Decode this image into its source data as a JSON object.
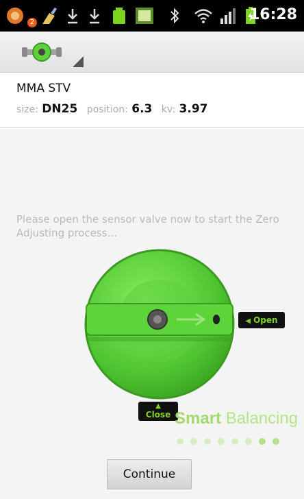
{
  "status_bar": {
    "time": "16:28",
    "notification_count": "2",
    "icons": [
      "notification-app-icon",
      "cleaner-icon",
      "download-icon",
      "download-icon",
      "battery-app-icon",
      "checklist-icon",
      "bluetooth-icon",
      "wifi-icon",
      "signal-icon",
      "battery-charging-icon"
    ]
  },
  "action_bar": {
    "logo_icon": "valve-logo-icon",
    "spinner_icon": "dropdown-triangle-icon"
  },
  "valve": {
    "name": "MMA STV",
    "size_label": "size:",
    "size_value": "DN25",
    "position_label": "position:",
    "position_value": "6.3",
    "kv_label": "kv:",
    "kv_value": "3.97"
  },
  "instruction": "Please open the sensor valve now to start the Zero Adjusting process...",
  "open_button": {
    "label": "Open"
  },
  "close_button": {
    "label": "Close"
  },
  "brand": {
    "part1": "Smart",
    "part2": " Balancing"
  },
  "progress": {
    "total": 8,
    "active": [
      6,
      7
    ]
  },
  "continue_button": {
    "label": "Continue"
  },
  "colors": {
    "valve_green": "#5fd13f",
    "accent_green": "#7ed321",
    "status_bar": "#000000"
  }
}
